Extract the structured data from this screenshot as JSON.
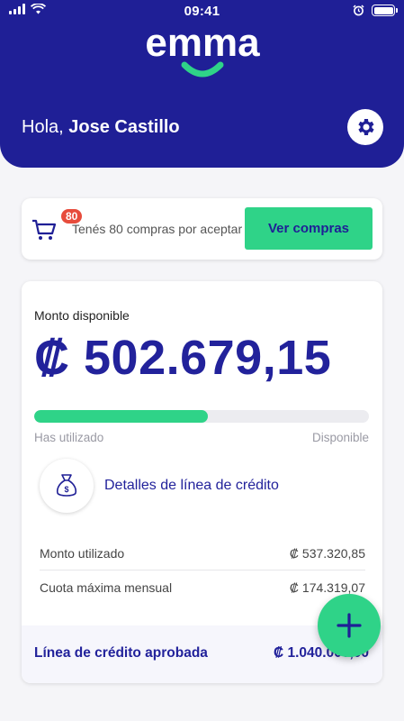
{
  "status_bar": {
    "time": "09:41"
  },
  "header": {
    "brand": "emma",
    "greeting_prefix": "Hola,",
    "user_name": "Jose Castillo"
  },
  "purchases": {
    "badge_count": "80",
    "text": "Tenés 80 compras por aceptar",
    "button_label": "Ver compras"
  },
  "credit": {
    "available_label": "Monto disponible",
    "available_amount": "₡ 502.679,15",
    "used_fraction": 0.52,
    "used_label": "Has utilizado",
    "available_short_label": "Disponible",
    "details_label": "Detalles de línea de crédito",
    "rows": [
      {
        "label": "Monto utilizado",
        "value": "₡ 537.320,85"
      },
      {
        "label": "Cuota máxima mensual",
        "value": "₡ 174.319,07"
      }
    ],
    "approved_label": "Línea de crédito aprobada",
    "approved_value": "₡ 1.040.000,00"
  },
  "colors": {
    "primary": "#1f1f96",
    "accent": "#2fd388",
    "badge": "#e74c3c"
  }
}
